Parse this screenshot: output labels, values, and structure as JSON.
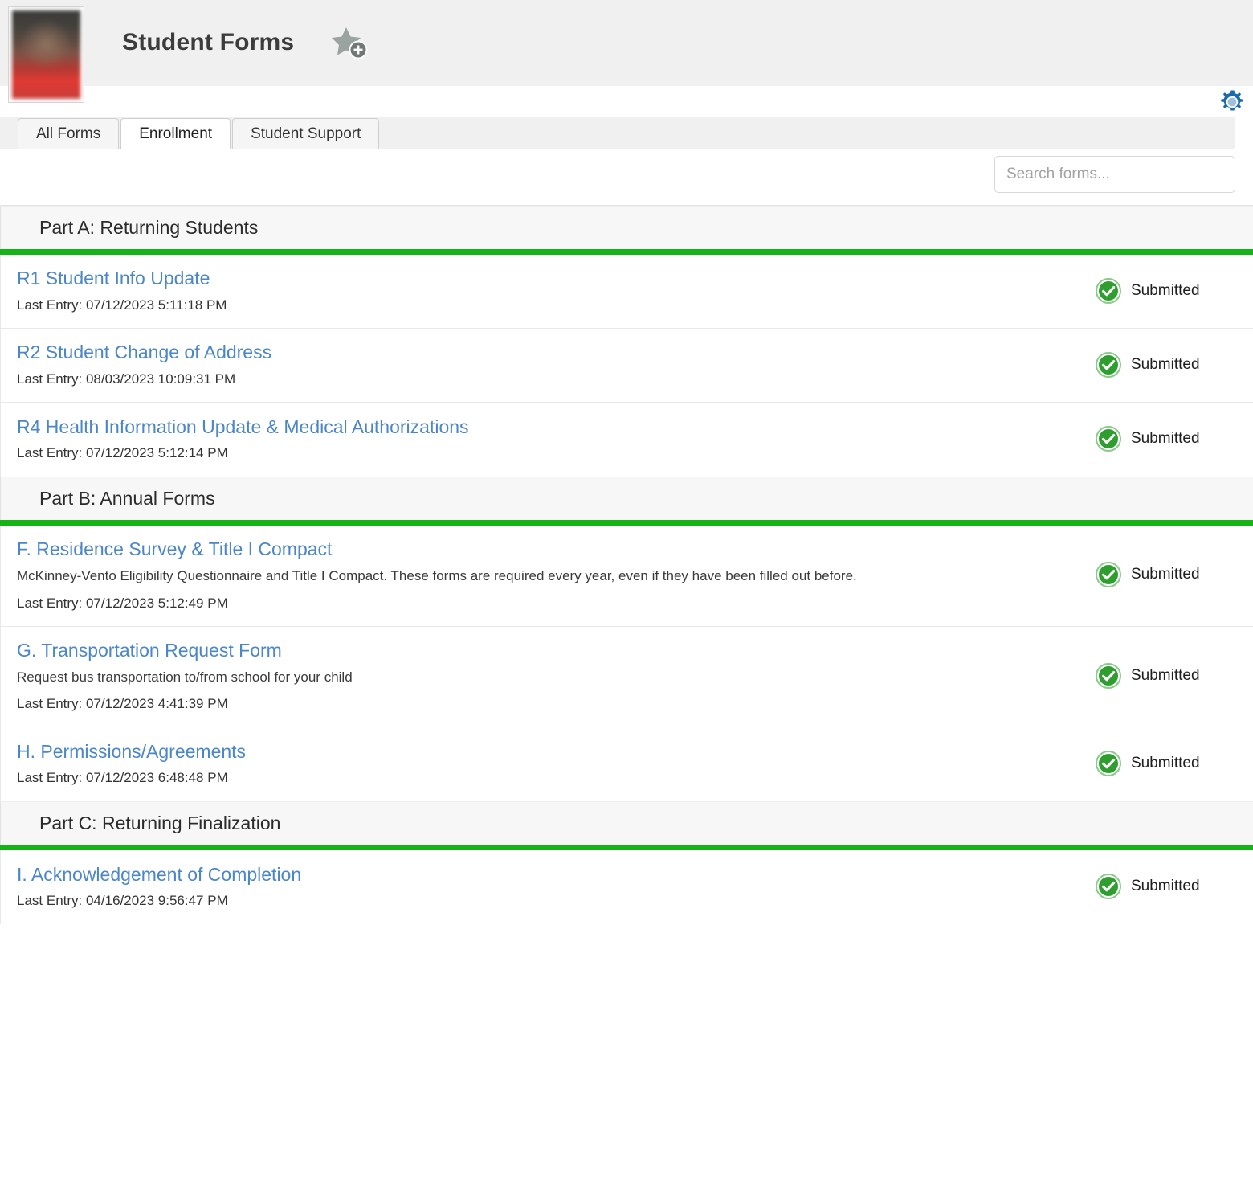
{
  "header": {
    "title": "Student Forms",
    "avatar_name": "student-avatar",
    "favorite_icon": "star-add-icon",
    "settings_icon": "gear-icon"
  },
  "tabs": [
    {
      "label": "All Forms",
      "active": false
    },
    {
      "label": "Enrollment",
      "active": true
    },
    {
      "label": "Student Support",
      "active": false
    }
  ],
  "search": {
    "placeholder": "Search forms...",
    "value": ""
  },
  "colors": {
    "accent_green": "#16b316",
    "link_blue": "#4a86c8",
    "gear_blue": "#1a6ca8",
    "status_green": "#2e9e2e",
    "header_gray": "#f0f0f0"
  },
  "status_labels": {
    "submitted": "Submitted"
  },
  "sections": [
    {
      "title": "Part A: Returning Students",
      "forms": [
        {
          "name": "R1 Student Info Update",
          "description": "",
          "last_entry": "Last Entry: 07/12/2023 5:11:18 PM",
          "status": "Submitted",
          "status_icon": "check-circle-icon"
        },
        {
          "name": "R2 Student Change of Address",
          "description": "",
          "last_entry": "Last Entry: 08/03/2023 10:09:31 PM",
          "status": "Submitted",
          "status_icon": "check-circle-icon"
        },
        {
          "name": "R4 Health Information Update & Medical Authorizations",
          "description": "",
          "last_entry": "Last Entry: 07/12/2023 5:12:14 PM",
          "status": "Submitted",
          "status_icon": "check-circle-icon"
        }
      ]
    },
    {
      "title": "Part B: Annual Forms",
      "forms": [
        {
          "name": "F. Residence Survey & Title I Compact",
          "description": "McKinney-Vento Eligibility Questionnaire and Title I Compact. These forms are required every year, even if they have been filled out before.",
          "last_entry": "Last Entry: 07/12/2023 5:12:49 PM",
          "status": "Submitted",
          "status_icon": "check-circle-icon"
        },
        {
          "name": "G. Transportation Request Form",
          "description": "Request bus transportation to/from school for your child",
          "last_entry": "Last Entry: 07/12/2023 4:41:39 PM",
          "status": "Submitted",
          "status_icon": "check-circle-icon"
        },
        {
          "name": "H. Permissions/Agreements",
          "description": "",
          "last_entry": "Last Entry: 07/12/2023 6:48:48 PM",
          "status": "Submitted",
          "status_icon": "check-circle-icon"
        }
      ]
    },
    {
      "title": "Part C: Returning Finalization",
      "forms": [
        {
          "name": "I. Acknowledgement of Completion",
          "description": "",
          "last_entry": "Last Entry: 04/16/2023 9:56:47 PM",
          "status": "Submitted",
          "status_icon": "check-circle-icon"
        }
      ]
    }
  ]
}
